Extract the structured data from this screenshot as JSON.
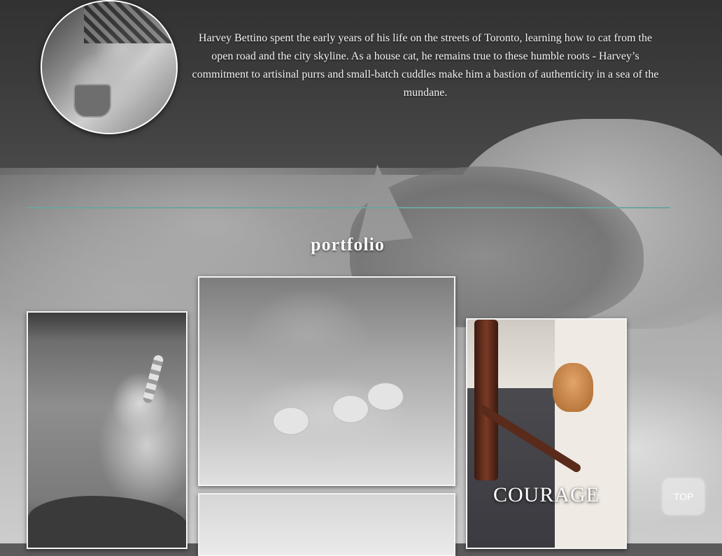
{
  "about": {
    "avatar_icon": "cat-portrait-image",
    "bio": "Harvey Bettino spent the early years of his life on the streets of Toronto, learning how to cat from the open road and the city skyline. As a house cat, he remains true to these humble roots - Harvey’s commitment to artisinal purrs and small-batch cuddles make him a bastion of authenticity in a sea of the mundane."
  },
  "portfolio": {
    "title": "portfolio",
    "items": [
      {
        "caption": ""
      },
      {
        "caption": ""
      },
      {
        "caption": ""
      },
      {
        "caption": "COURAGE"
      }
    ]
  },
  "controls": {
    "top_label": "TOP"
  },
  "colors": {
    "divider": "#6fa3a0"
  }
}
